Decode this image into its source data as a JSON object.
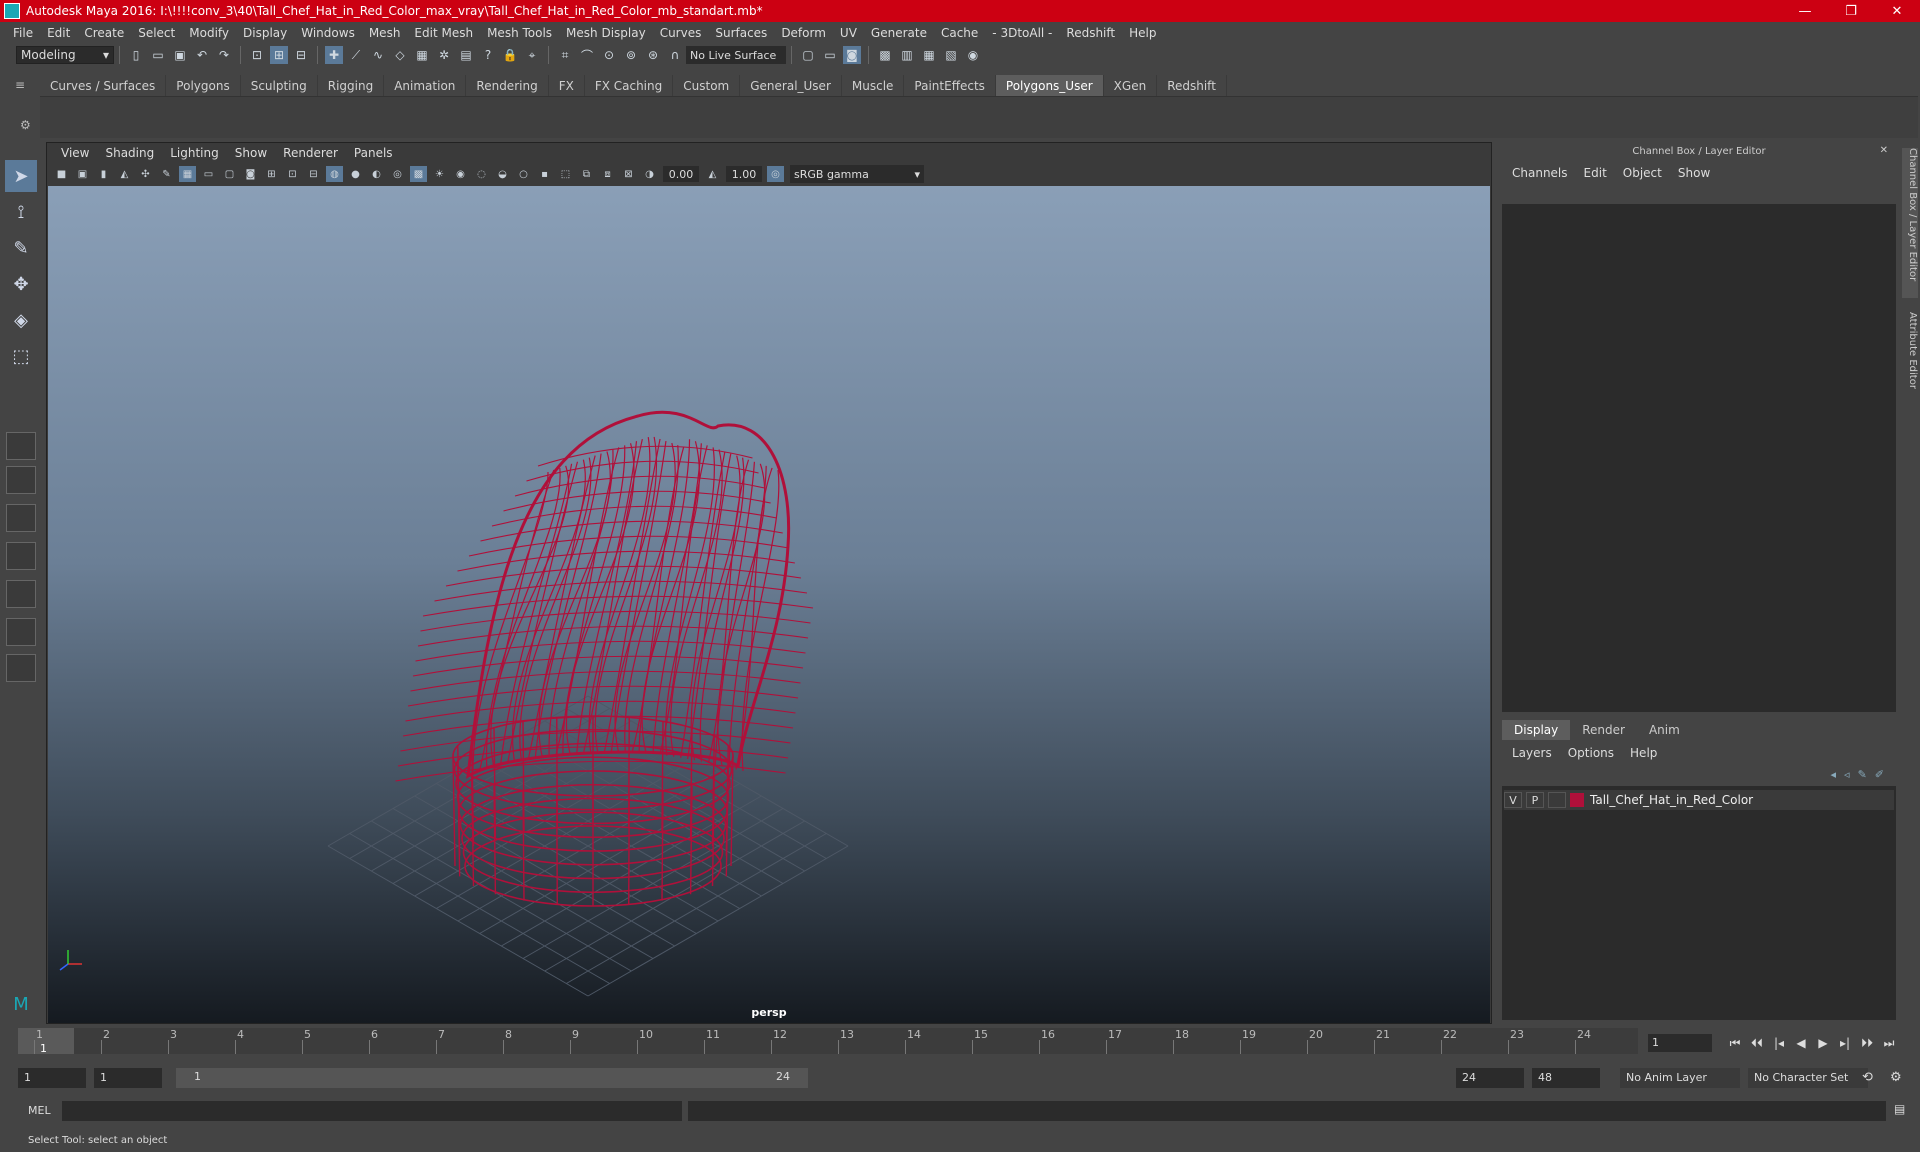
{
  "window": {
    "title": "Autodesk Maya 2016: I:\\!!!!conv_3\\40\\Tall_Chef_Hat_in_Red_Color_max_vray\\Tall_Chef_Hat_in_Red_Color_mb_standart.mb*",
    "minimize": "—",
    "restore": "❐",
    "close": "✕"
  },
  "menubar": [
    "File",
    "Edit",
    "Create",
    "Select",
    "Modify",
    "Display",
    "Windows",
    "Mesh",
    "Edit Mesh",
    "Mesh Tools",
    "Mesh Display",
    "Curves",
    "Surfaces",
    "Deform",
    "UV",
    "Generate",
    "Cache",
    "- 3DtoAll -",
    "Redshift",
    "Help"
  ],
  "statusline": {
    "mode": "Modeling",
    "live_surface": "No Live Surface"
  },
  "shelf": {
    "tabs": [
      "Curves / Surfaces",
      "Polygons",
      "Sculpting",
      "Rigging",
      "Animation",
      "Rendering",
      "FX",
      "FX Caching",
      "Custom",
      "General_User",
      "Muscle",
      "PaintEffects",
      "Polygons_User",
      "XGen",
      "Redshift"
    ],
    "active_tab": "Polygons_User"
  },
  "viewport": {
    "menu": [
      "View",
      "Shading",
      "Lighting",
      "Show",
      "Renderer",
      "Panels"
    ],
    "exposure": "0.00",
    "gamma_value": "1.00",
    "color_space": "sRGB gamma",
    "camera": "persp",
    "wire_color": "#b0103a"
  },
  "channel_box": {
    "title": "Channel Box / Layer Editor",
    "menu": [
      "Channels",
      "Edit",
      "Object",
      "Show"
    ],
    "layer_tabs": [
      "Display",
      "Render",
      "Anim"
    ],
    "active_layer_tab": "Display",
    "layer_menu": [
      "Layers",
      "Options",
      "Help"
    ],
    "layer": {
      "v": "V",
      "p": "P",
      "name": "Tall_Chef_Hat_in_Red_Color",
      "color": "#b0103a"
    }
  },
  "side_tabs": [
    "Channel Box / Layer Editor",
    "Attribute Editor"
  ],
  "timeline": {
    "ticks": [
      "1",
      "2",
      "3",
      "4",
      "5",
      "6",
      "7",
      "8",
      "9",
      "10",
      "11",
      "12",
      "13",
      "14",
      "15",
      "16",
      "17",
      "18",
      "19",
      "20",
      "21",
      "22",
      "23",
      "24"
    ],
    "current_frame": "1",
    "current_time": "1"
  },
  "range": {
    "start": "1",
    "playback_start": "1",
    "slider_start": "1",
    "slider_end": "24",
    "playback_end": "24",
    "end": "48",
    "anim_layer": "No Anim Layer",
    "character_set": "No Character Set"
  },
  "command": {
    "language": "MEL",
    "help_text": "Select Tool: select an object"
  }
}
